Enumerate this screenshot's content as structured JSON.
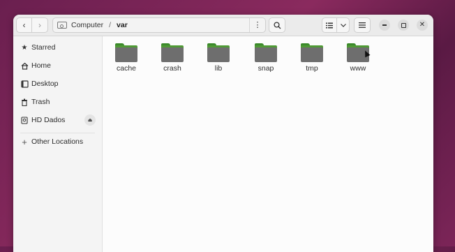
{
  "header": {
    "path": {
      "root": "Computer",
      "separator": "/",
      "current": "var"
    },
    "icons": {
      "back": "chevron-left-icon",
      "forward": "chevron-right-icon",
      "path_menu": "vertical-dots-icon",
      "search": "search-icon",
      "list_view": "list-view-icon",
      "view_options": "chevron-down-icon",
      "main_menu": "hamburger-icon",
      "minimize": "minimize-icon",
      "maximize": "maximize-icon",
      "close": "close-icon"
    }
  },
  "sidebar": {
    "items": [
      {
        "label": "Starred",
        "icon": "star-icon"
      },
      {
        "label": "Home",
        "icon": "home-icon"
      },
      {
        "label": "Desktop",
        "icon": "desktop-icon"
      },
      {
        "label": "Trash",
        "icon": "trash-icon"
      },
      {
        "label": "HD Dados",
        "icon": "drive-icon"
      },
      {
        "label": "Other Locations",
        "icon": "plus-icon"
      }
    ]
  },
  "content": {
    "folders": [
      "cache",
      "crash",
      "lib",
      "snap",
      "tmp",
      "www"
    ],
    "folder_color": "#6e6e6e",
    "folder_accent": "#4f9a35"
  }
}
